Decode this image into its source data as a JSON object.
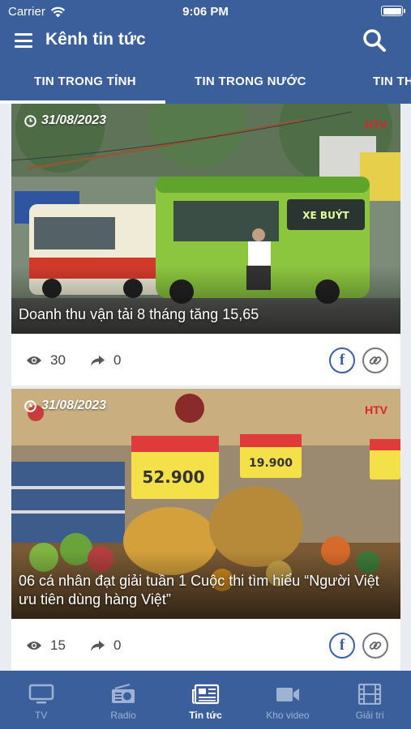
{
  "status": {
    "carrier": "Carrier",
    "time": "9:06 PM"
  },
  "app": {
    "title": "Kênh tin tức"
  },
  "tabs": [
    {
      "label": "TIN TRONG TỈNH",
      "active": true
    },
    {
      "label": "TIN TRONG NƯỚC",
      "active": false
    },
    {
      "label": "TIN TH",
      "active": false
    }
  ],
  "articles": [
    {
      "date": "31/08/2023",
      "title": "Doanh thu vận tải 8 tháng tăng 15,65",
      "views": "30",
      "shares": "0",
      "logo": "HTV",
      "image": "city-buses"
    },
    {
      "date": "31/08/2023",
      "title": "06 cá nhân đạt giải tuần 1 Cuộc thi tìm hiểu “Người Việt ưu tiên dùng hàng Việt”",
      "views": "15",
      "shares": "0",
      "logo": "HTV",
      "image": "supermarket-fruit"
    }
  ],
  "nav": [
    {
      "label": "TV",
      "icon": "tv-icon",
      "active": false
    },
    {
      "label": "Radio",
      "icon": "radio-icon",
      "active": false
    },
    {
      "label": "Tin tức",
      "icon": "newspaper-icon",
      "active": true
    },
    {
      "label": "Kho video",
      "icon": "video-camera-icon",
      "active": false
    },
    {
      "label": "Giải trí",
      "icon": "film-icon",
      "active": false
    }
  ],
  "colors": {
    "primary": "#3a5f9b",
    "facebook": "#3b5ea7",
    "background": "#e9ecf1"
  }
}
